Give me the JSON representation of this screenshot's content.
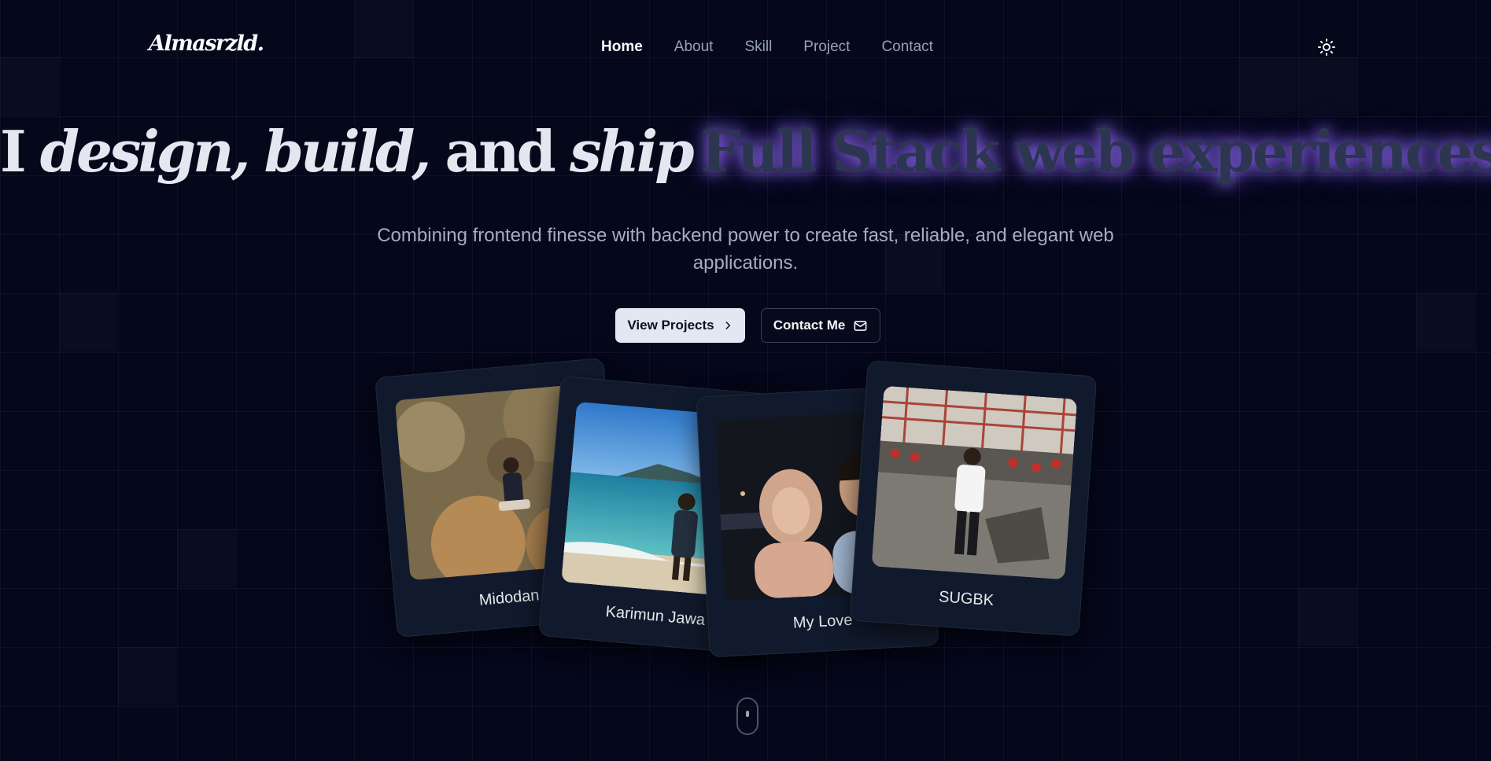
{
  "nav": {
    "logo": "Almasrzld.",
    "items": [
      {
        "label": "Home",
        "active": true
      },
      {
        "label": "About"
      },
      {
        "label": "Skill"
      },
      {
        "label": "Project"
      },
      {
        "label": "Contact"
      }
    ],
    "theme_icon": "sun-icon"
  },
  "hero": {
    "title_I": "I",
    "title_design": "design,",
    "title_build": "build,",
    "title_and": "and",
    "title_ship": "ship",
    "title_highlight": "Full Stack web experiences",
    "subtitle": "Combining frontend finesse with backend power to create fast, reliable, and elegant web applications.",
    "primary_button": "View Projects",
    "primary_icon": "chevron-right-icon",
    "secondary_button": "Contact Me",
    "secondary_icon": "mail-icon"
  },
  "cards": [
    {
      "caption": "Midodan"
    },
    {
      "caption": "Karimun Jawa"
    },
    {
      "caption": "My Love"
    },
    {
      "caption": "SUGBK"
    }
  ],
  "colors": {
    "background": "#05071a",
    "accent_glow": "#9a6eff",
    "card": "#111a2c"
  }
}
